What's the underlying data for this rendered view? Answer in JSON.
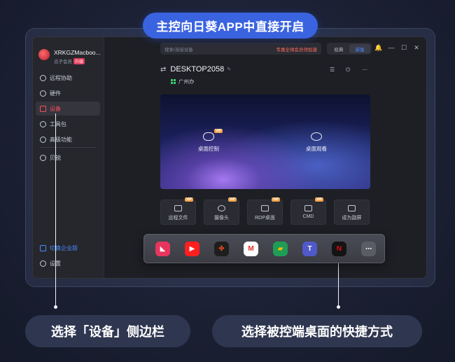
{
  "banner": "主控向日葵APP中直接开启",
  "profile": {
    "name": "XRKGZMacboo...",
    "sub": "瓜子会员",
    "tag": "升级"
  },
  "sidebar": {
    "items": [
      {
        "label": "远程协助",
        "icon": "remote-assist-icon"
      },
      {
        "label": "硬件",
        "icon": "hardware-icon"
      },
      {
        "label": "设备",
        "icon": "device-monitor-icon",
        "active": true
      },
      {
        "label": "工具包",
        "icon": "toolbox-icon"
      },
      {
        "label": "高级功能",
        "icon": "advanced-icon"
      },
      {
        "label": "贝锐",
        "icon": "oray-icon"
      }
    ],
    "switch_enterprise": "切换企业版",
    "settings": "设置"
  },
  "toolbar": {
    "search_placeholder": "搜索/连接设备",
    "promo": "专属全球会员领加速",
    "mode_classic": "经典",
    "mode_new": "新版",
    "bell": "🔔",
    "minimize": "—",
    "maximize": "☐",
    "close": "✕"
  },
  "device": {
    "name": "DESKTOP2058",
    "swap": "⇄",
    "edit": "✎",
    "location": "广州办",
    "list": "☰",
    "power": "⏻",
    "more": "⋯"
  },
  "preview": {
    "desktop_control": "桌面控制",
    "desktop_view": "桌面观看",
    "vip": "VIP"
  },
  "shortcuts": [
    {
      "label": "远程文件",
      "vip": "VIP"
    },
    {
      "label": "摄像头",
      "vip": "VIP"
    },
    {
      "label": "RDP桌面",
      "vip": "VIP"
    },
    {
      "label": "CMD",
      "vip": "VIP"
    },
    {
      "label": "成为副屏",
      "vip": ""
    }
  ],
  "dock_apps": [
    {
      "name": "sunlogin-app-icon",
      "color": "#e8355e",
      "glyph": "◣"
    },
    {
      "name": "youtube-icon",
      "color": "#ff1f1f",
      "glyph": "▶"
    },
    {
      "name": "figma-icon",
      "color": "#1e1e1e",
      "glyph": "✤"
    },
    {
      "name": "gmail-icon",
      "color": "#ffffff",
      "glyph": "M"
    },
    {
      "name": "google-meet-icon",
      "color": "#1f9d55",
      "glyph": "▰"
    },
    {
      "name": "teams-icon",
      "color": "#5059c9",
      "glyph": "T"
    },
    {
      "name": "netflix-icon",
      "color": "#141414",
      "glyph": "N"
    },
    {
      "name": "more-apps-icon",
      "color": "#5a5c66",
      "glyph": "⋯"
    }
  ],
  "callouts": {
    "left": "选择「设备」侧边栏",
    "right": "选择被控端桌面的快捷方式"
  }
}
